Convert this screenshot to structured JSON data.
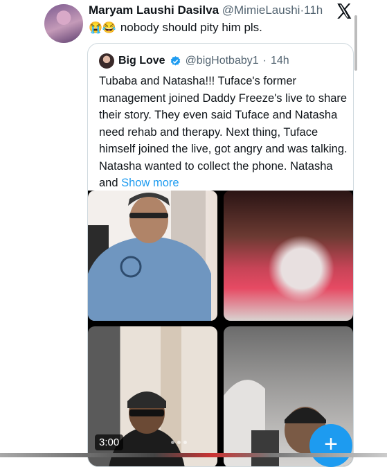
{
  "tweet": {
    "author_name": "Maryam Laushi Dasilva",
    "author_handle": "@MimieLaushi",
    "separator": "·",
    "time": "11h",
    "emojis": "😭😂",
    "text": "nobody should pity him pls."
  },
  "quoted": {
    "author_name": "Big Love",
    "author_handle": "@bigHotbaby1",
    "separator": "·",
    "time": "14h",
    "text": "Tubaba and Natasha!!! Tuface's former management joined Daddy Freeze's live to share their story. They even said Tuface and Natasha need rehab and therapy. Next thing, Tuface himself joined the live, got angry and was talking. Natasha wanted to collect the phone. Natasha and ",
    "show_more": "Show more",
    "video_duration": "3:00"
  },
  "fab_label": "+",
  "colors": {
    "accent": "#1d9bf0",
    "secondary_text": "#536471"
  },
  "icons": [
    "x-logo-icon",
    "verified-badge-icon",
    "plus-icon"
  ]
}
